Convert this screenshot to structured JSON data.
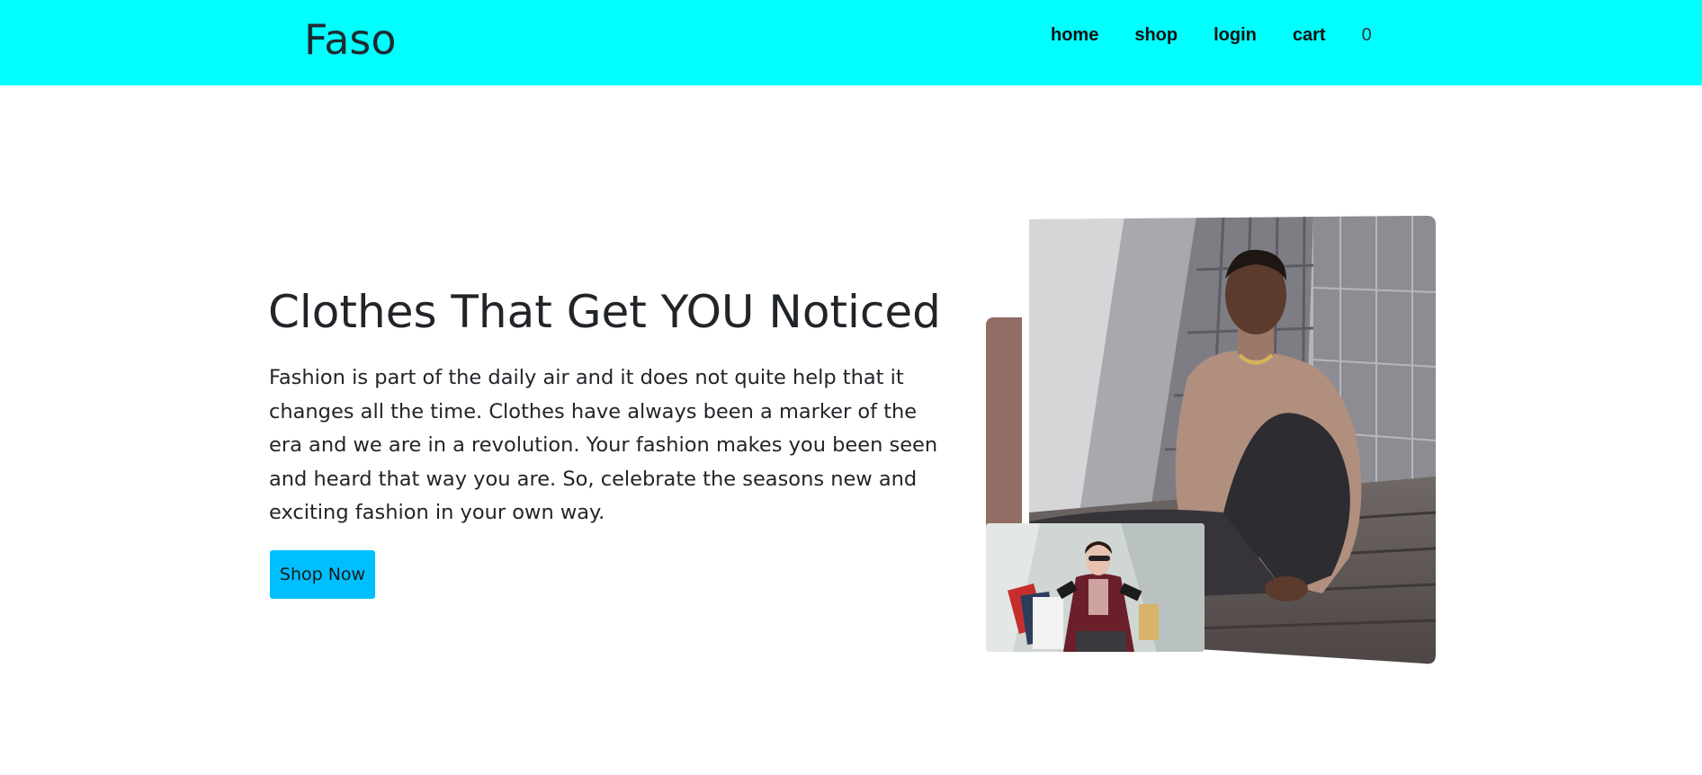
{
  "header": {
    "brand": "Faso",
    "nav": [
      "home",
      "shop",
      "login",
      "cart"
    ],
    "cart_count": "0",
    "background": "#00ffff"
  },
  "hero": {
    "title": "Clothes That Get YOU Noticed",
    "description": "Fashion is part of the daily air and it does not quite help that it changes all the time. Clothes have always been a marker of the era and we are in a revolution. Your fashion makes you been seen and heard that way you are. So, celebrate the seasons new and exciting fashion in your own way.",
    "cta_label": "Shop Now",
    "cta_color": "#00bfff",
    "accent_color": "#946c66"
  },
  "images": {
    "main": "man-in-turtleneck-photo",
    "inset": "woman-with-shopping-bags-photo"
  }
}
